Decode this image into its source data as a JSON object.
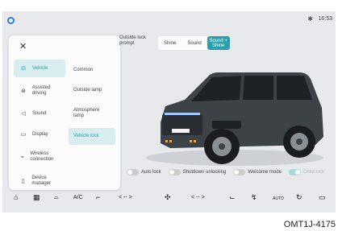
{
  "status": {
    "bluetooth_icon": "bluetooth-icon",
    "time": "16:53"
  },
  "panel": {
    "menu": [
      {
        "label": "Vehicle",
        "icon": "car-icon"
      },
      {
        "label": "Assisted driving",
        "icon": "steering-wheel-icon"
      },
      {
        "label": "Sound",
        "icon": "speaker-icon"
      },
      {
        "label": "Display",
        "icon": "display-icon"
      },
      {
        "label": "Wireless connection",
        "icon": "wireless-icon"
      },
      {
        "label": "Device manager",
        "icon": "phone-icon"
      }
    ],
    "submenu": [
      {
        "label": "Common"
      },
      {
        "label": "Outside lamp"
      },
      {
        "label": "Atmosphere lamp"
      },
      {
        "label": "Vehicle lock"
      }
    ]
  },
  "lock_prompt": {
    "label": "Outside lock prompt",
    "options": [
      "Shine",
      "Sound",
      "Sound + Shine"
    ],
    "selected": "Sound + Shine"
  },
  "toggles": [
    {
      "label": "Auto lock",
      "on": false
    },
    {
      "label": "Shutdown unlocking",
      "on": false
    },
    {
      "label": "Welcome mode",
      "on": false
    },
    {
      "label": "Child lock",
      "on": true
    }
  ],
  "bottom_bar": {
    "ac_label": "A/C",
    "left_temp": "< -- >",
    "right_temp": "< -- >",
    "auto_label": "AUTO"
  },
  "caption": "OMT1J-4175",
  "colors": {
    "accent": "#2ba0aa",
    "accent_light": "#d7edf0",
    "home_dot": "#2a7fd6"
  }
}
